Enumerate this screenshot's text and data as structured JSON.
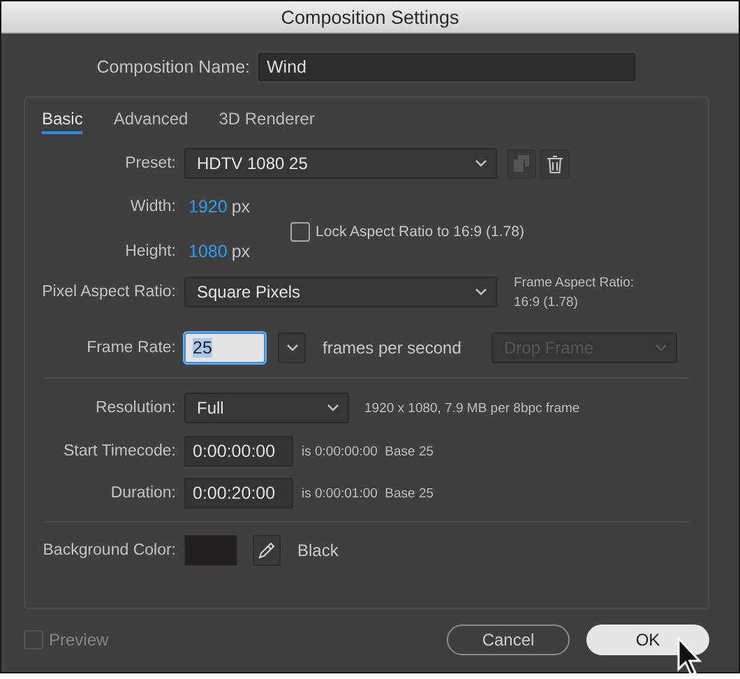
{
  "window": {
    "title": "Composition Settings"
  },
  "composition_name": {
    "label": "Composition Name:",
    "value": "Wind"
  },
  "tabs": [
    {
      "label": "Basic",
      "selected": true
    },
    {
      "label": "Advanced",
      "selected": false
    },
    {
      "label": "3D Renderer",
      "selected": false
    }
  ],
  "preset": {
    "label": "Preset:",
    "value": "HDTV 1080 25"
  },
  "width": {
    "label": "Width:",
    "value": "1920",
    "unit": "px"
  },
  "height": {
    "label": "Height:",
    "value": "1080",
    "unit": "px"
  },
  "lock_aspect": {
    "label": "Lock Aspect Ratio to 16:9 (1.78)",
    "checked": false
  },
  "pixel_aspect": {
    "label": "Pixel Aspect Ratio:",
    "value": "Square Pixels",
    "note": [
      "Frame Aspect Ratio:",
      "16:9 (1.78)"
    ]
  },
  "frame_rate": {
    "label": "Frame Rate:",
    "value": "25",
    "focused": true,
    "unit": "frames per second",
    "drop_frame": {
      "value": "Drop Frame",
      "disabled": true
    }
  },
  "resolution": {
    "label": "Resolution:",
    "value": "Full",
    "info": "1920 x 1080, 7.9 MB per 8bpc frame"
  },
  "start_timecode": {
    "label": "Start Timecode:",
    "value": "0:00:00:00",
    "info": "is 0:00:00:00  Base 25"
  },
  "duration": {
    "label": "Duration:",
    "value": "0:00:20:00",
    "info": "is 0:00:01:00  Base 25"
  },
  "background_color": {
    "label": "Background Color:",
    "color": "#231f20",
    "name": "Black"
  },
  "preview": {
    "label": "Preview",
    "checked": false,
    "disabled": true
  },
  "buttons": [
    {
      "label": "Cancel",
      "default": false
    },
    {
      "label": "OK",
      "default": true
    }
  ]
}
